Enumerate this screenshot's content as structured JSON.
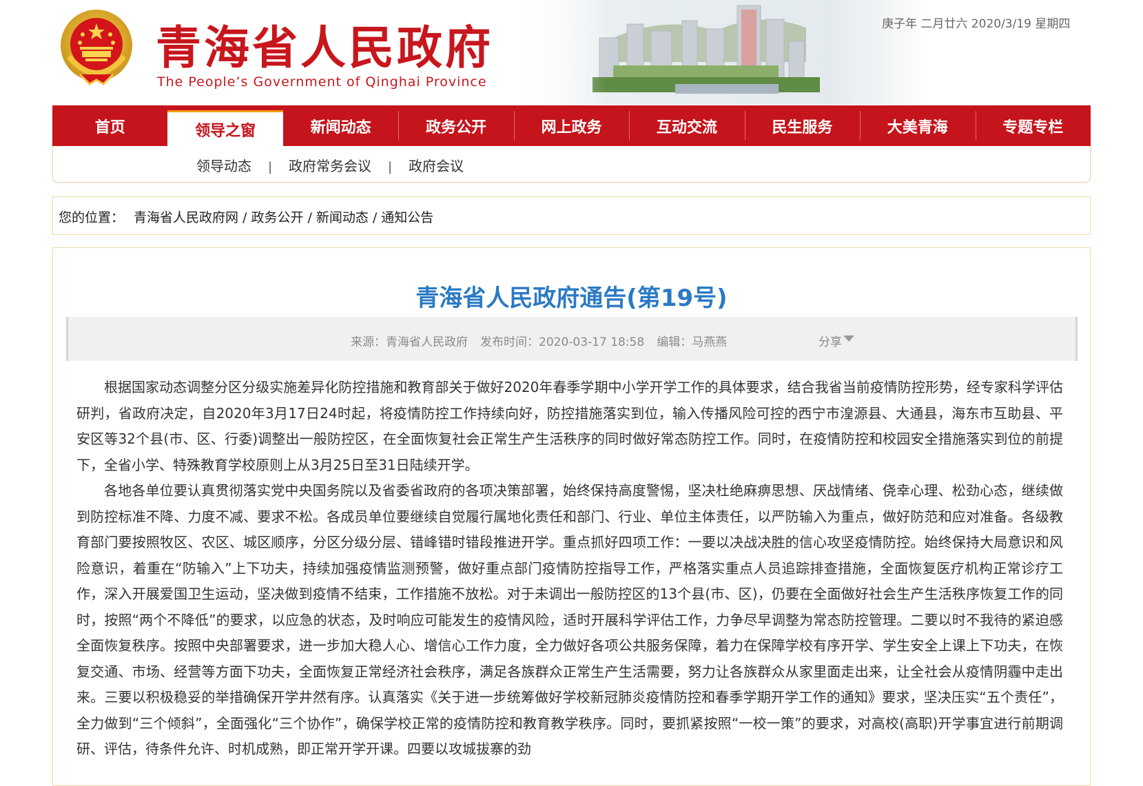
{
  "header": {
    "title": "青海省人民政府",
    "subtitle": "The People’s Government of Qinghai Province",
    "date": "庚子年 二月廿六 2020/3/19 星期四"
  },
  "nav": {
    "items": [
      "首页",
      "领导之窗",
      "新闻动态",
      "政务公开",
      "网上政务",
      "互动交流",
      "民生服务",
      "大美青海",
      "专题专栏"
    ],
    "active_index": 1
  },
  "subnav": {
    "items": [
      "领导动态",
      "政府常务会议",
      "政府会议"
    ],
    "separator": "|"
  },
  "breadcrumb": {
    "label": "您的位置：",
    "items": [
      "青海省人民政府网",
      "政务公开",
      "新闻动态",
      "通知公告"
    ],
    "separator": "/"
  },
  "article": {
    "title": "青海省人民政府通告(第19号)",
    "meta": {
      "source_label": "来源：",
      "source": "青海省人民政府",
      "time_label": "发布时间：",
      "time": "2020-03-17 18:58",
      "editor_label": "编辑：",
      "editor": "马燕燕",
      "share": "分享"
    },
    "paragraphs": [
      "根据国家动态调整分区分级实施差异化防控措施和教育部关于做好2020年春季学期中小学开学工作的具体要求，结合我省当前疫情防控形势，经专家科学评估研判，省政府决定，自2020年3月17日24时起，将疫情防控工作持续向好，防控措施落实到位，输入传播风险可控的西宁市湟源县、大通县，海东市互助县、平安区等32个县(市、区、行委)调整出一般防控区，在全面恢复社会正常生产生活秩序的同时做好常态防控工作。同时，在疫情防控和校园安全措施落实到位的前提下，全省小学、特殊教育学校原则上从3月25日至31日陆续开学。",
      "各地各单位要认真贯彻落实党中央国务院以及省委省政府的各项决策部署，始终保持高度警惕，坚决杜绝麻痹思想、厌战情绪、侥幸心理、松劲心态，继续做到防控标准不降、力度不减、要求不松。各成员单位要继续自觉履行属地化责任和部门、行业、单位主体责任，以严防输入为重点，做好防范和应对准备。各级教育部门要按照牧区、农区、城区顺序，分区分级分层、错峰错时错段推进开学。重点抓好四项工作：一要以决战决胜的信心攻坚疫情防控。始终保持大局意识和风险意识，着重在“防输入”上下功夫，持续加强疫情监测预警，做好重点部门疫情防控指导工作，严格落实重点人员追踪排查措施，全面恢复医疗机构正常诊疗工作，深入开展爱国卫生运动，坚决做到疫情不结束，工作措施不放松。对于未调出一般防控区的13个县(市、区)，仍要在全面做好社会生产生活秩序恢复工作的同时，按照“两个不降低”的要求，以应急的状态，及时响应可能发生的疫情风险，适时开展科学评估工作，力争尽早调整为常态防控管理。二要以时不我待的紧迫感全面恢复秩序。按照中央部署要求，进一步加大稳人心、增信心工作力度，全力做好各项公共服务保障，着力在保障学校有序开学、学生安全上课上下功夫，在恢复交通、市场、经营等方面下功夫，全面恢复正常经济社会秩序，满足各族群众正常生产生活需要，努力让各族群众从家里面走出来，让全社会从疫情阴霾中走出来。三要以积极稳妥的举措确保开学井然有序。认真落实《关于进一步统筹做好学校新冠肺炎疫情防控和春季学期开学工作的通知》要求，坚决压实“五个责任”，全力做到“三个倾斜”，全面强化“三个协作”，确保学校正常的疫情防控和教育教学秩序。同时，要抓紧按照“一校一策”的要求，对高校(高职)开学事宜进行前期调研、评估，待条件允许、时机成熟，即正常开学开课。四要以攻城拔寨的劲"
    ]
  },
  "colors": {
    "brand_red": "#c5141b",
    "title_blue": "#2b7ac4",
    "border_gold": "#f1d9a2"
  },
  "icons": [
    "national-emblem-icon",
    "share-dropdown-icon"
  ]
}
